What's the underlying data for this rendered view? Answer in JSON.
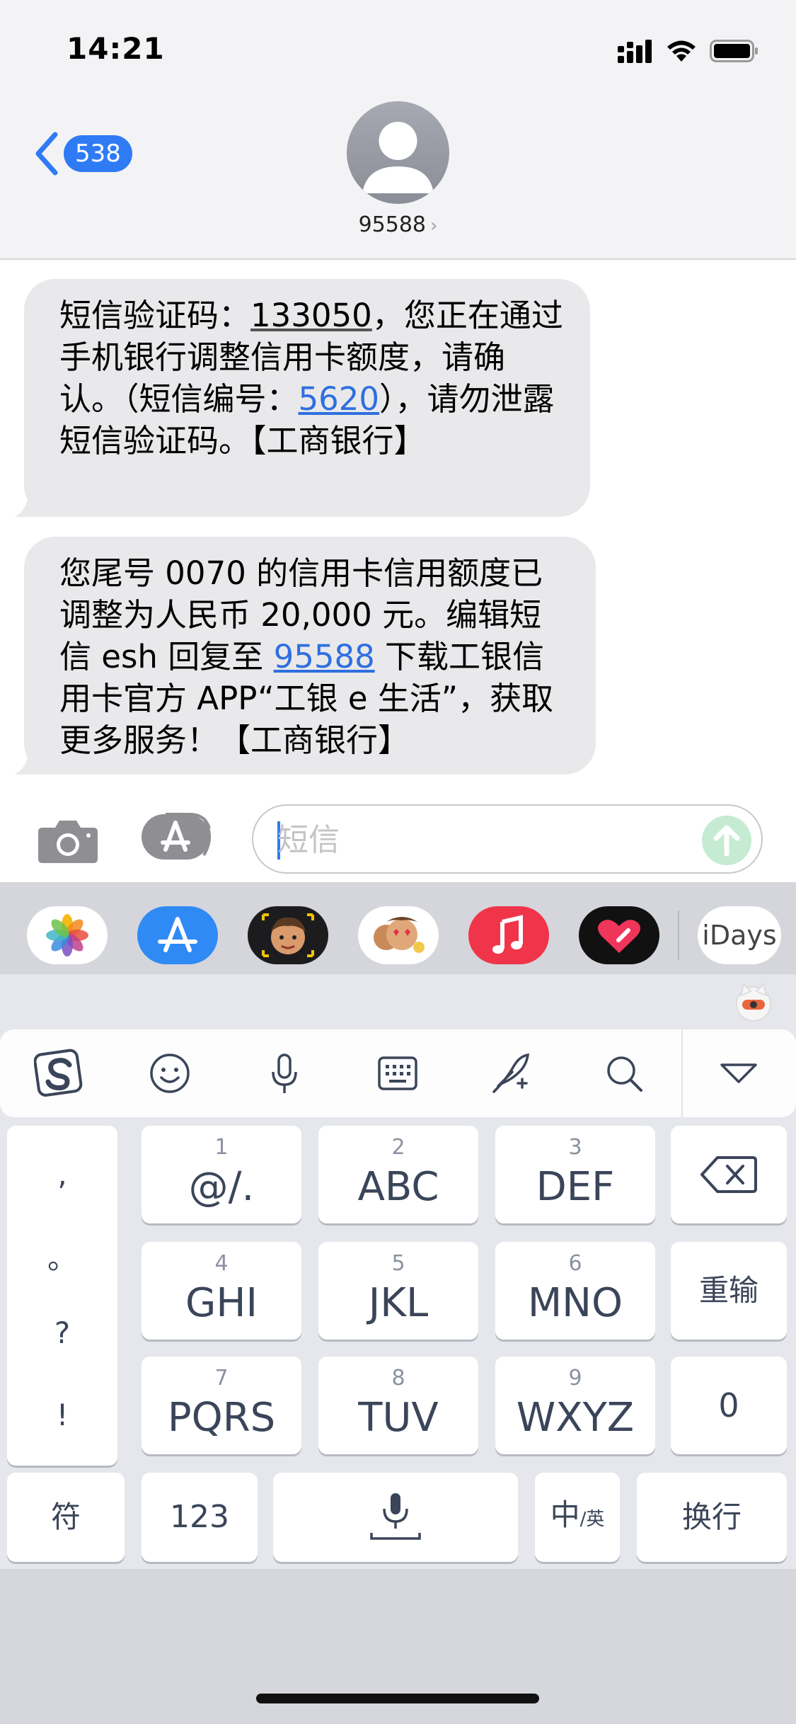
{
  "status_bar": {
    "time": "14:21"
  },
  "header": {
    "back_badge": "538",
    "contact_name": "95588",
    "contact_chevron": "›"
  },
  "messages": [
    {
      "parts": {
        "p1": "短信验证码：",
        "code": "133050",
        "p2": "，您正在通过手机银行调整信用卡额度，请确认。（短信编号：",
        "ref": "5620",
        "p3": "），请勿泄露短信验证码。【工商银行】"
      }
    },
    {
      "parts": {
        "p1": "您尾号 0070 的信用卡信用额度已调整为人民币 20,000 元。编辑短信 esh 回复至 ",
        "link": "95588",
        "p2": " 下载工银信用卡官方 APP“工银 e 生活”，获取更多服务！【工商银行】"
      }
    }
  ],
  "compose": {
    "placeholder": "短信"
  },
  "app_drawer": {
    "items": [
      "photos-icon",
      "app-store-icon",
      "memoji-icon",
      "animoji-icon",
      "music-icon",
      "digital-touch-icon",
      "idays-app"
    ],
    "idays_label": "iDays"
  },
  "keyboard": {
    "punctuation": [
      ",",
      "。",
      "?",
      "!"
    ],
    "rows": [
      [
        {
          "num": "1",
          "letters": "@/."
        },
        {
          "num": "2",
          "letters": "ABC"
        },
        {
          "num": "3",
          "letters": "DEF"
        }
      ],
      [
        {
          "num": "4",
          "letters": "GHI"
        },
        {
          "num": "5",
          "letters": "JKL"
        },
        {
          "num": "6",
          "letters": "MNO"
        }
      ],
      [
        {
          "num": "7",
          "letters": "PQRS"
        },
        {
          "num": "8",
          "letters": "TUV"
        },
        {
          "num": "9",
          "letters": "WXYZ"
        }
      ]
    ],
    "reenter": "重输",
    "zero": "0",
    "symbols": "符",
    "numbers": "123",
    "lang_main": "中",
    "lang_sub": "/英",
    "return": "换行"
  },
  "colors": {
    "link": "#2f6fe0",
    "accent": "#2f7bf5",
    "bubble": "#e9e9eb"
  }
}
